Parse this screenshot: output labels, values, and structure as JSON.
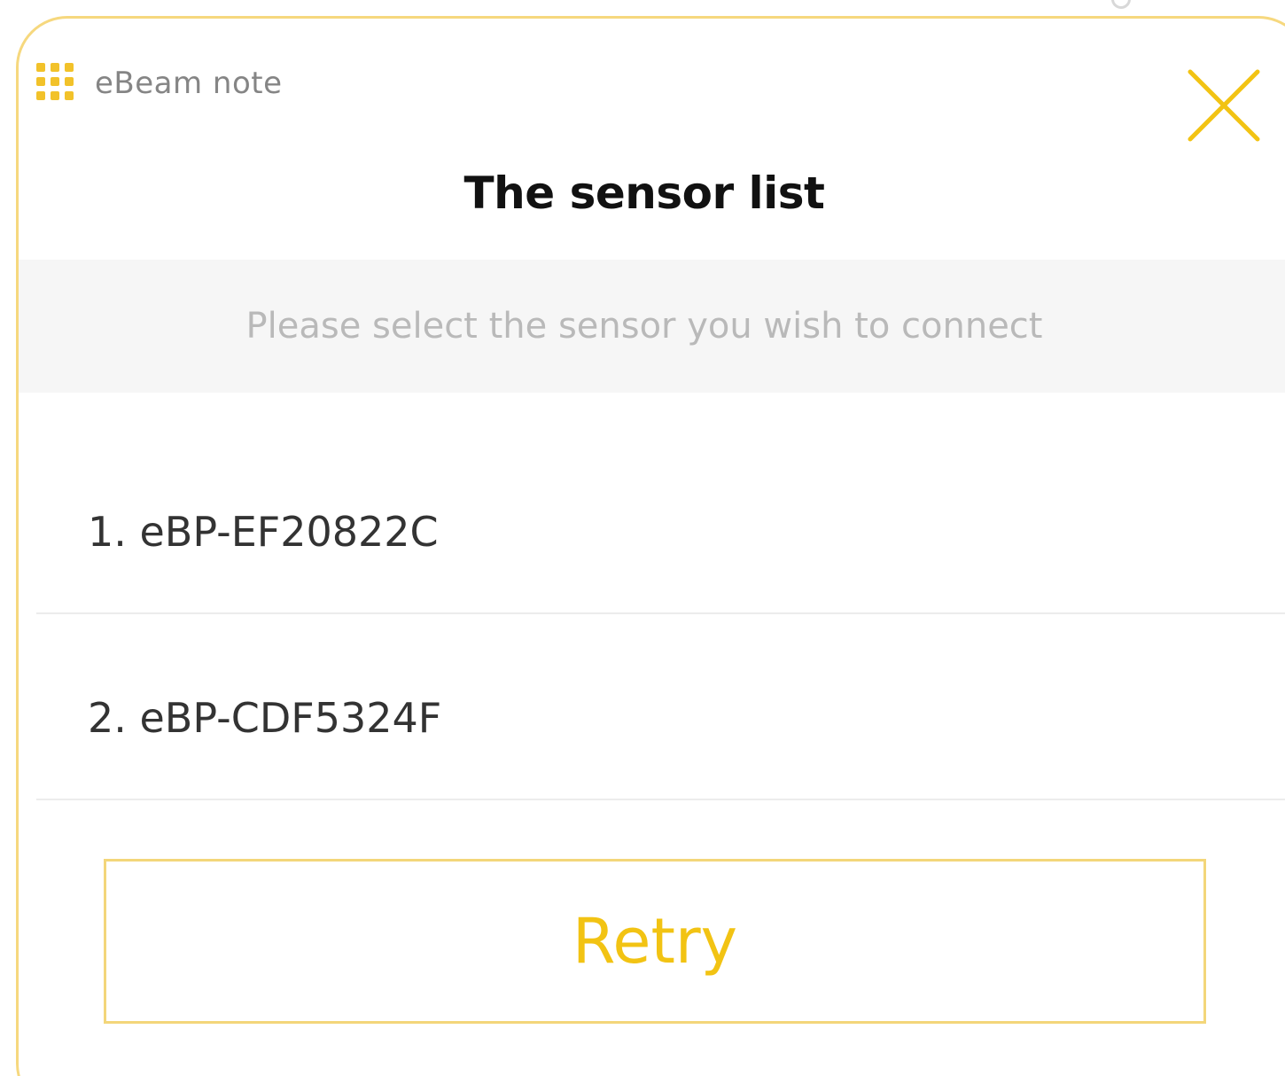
{
  "app": {
    "name": "eBeam note",
    "icon": "grid-dots-icon"
  },
  "dialog": {
    "title": "The sensor list",
    "instruction": "Please select the sensor you wish to connect",
    "close_icon": "close-icon",
    "sensors": [
      {
        "label": "1. eBP-EF20822C"
      },
      {
        "label": "2. eBP-CDF5324F"
      }
    ],
    "retry_label": "Retry"
  },
  "colors": {
    "accent": "#f2c313",
    "border": "#f6d87e",
    "instruction_bg": "#f6f6f6",
    "instruction_text": "#b9b9b9",
    "title_text": "#111111"
  }
}
